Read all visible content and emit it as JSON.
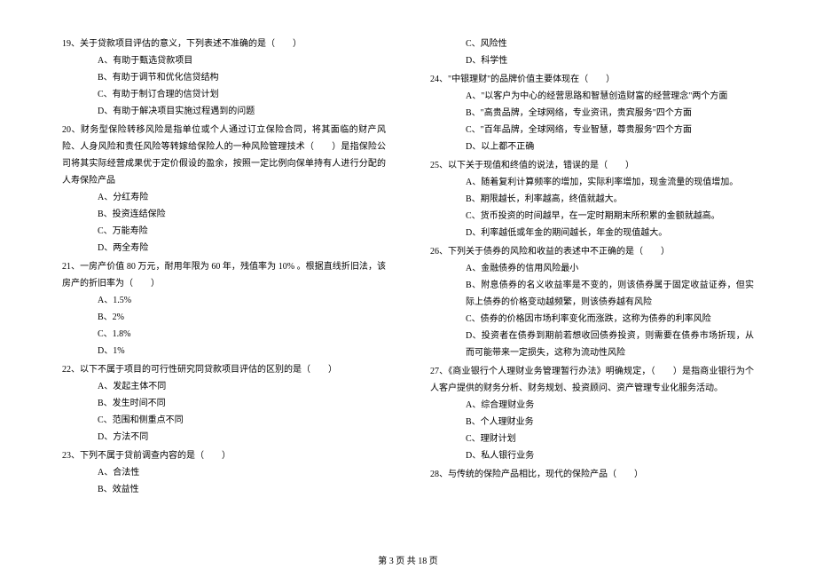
{
  "left_column": {
    "q19": {
      "text": "19、关于贷款项目评估的意义，下列表述不准确的是（　　）",
      "options": {
        "a": "A、有助于甄选贷款项目",
        "b": "B、有助于调节和优化信贷结构",
        "c": "C、有助于制订合理的信贷计划",
        "d": "D、有助于解决项目实施过程遇到的问题"
      }
    },
    "q20": {
      "text": "20、财务型保险转移风险是指单位或个人通过订立保险合同，将其面临的财产风险、人身风险和责任风险等转嫁给保险人的一种风险管理技术（　　）是指保险公司将其实际经营成果优于定价假设的盈余，按照一定比例向保单持有人进行分配的人寿保险产品",
      "options": {
        "a": "A、分红寿险",
        "b": "B、投资连结保险",
        "c": "C、万能寿险",
        "d": "D、两全寿险"
      }
    },
    "q21": {
      "text": "21、一房产价值 80 万元，耐用年限为 60 年，残值率为 10% 。根据直线折旧法，该房产的折旧率为（　　）",
      "options": {
        "a": "A、1.5%",
        "b": "B、2%",
        "c": "C、1.8%",
        "d": "D、1%"
      }
    },
    "q22": {
      "text": "22、以下不属于项目的可行性研究同贷款项目评估的区别的是（　　）",
      "options": {
        "a": "A、发起主体不同",
        "b": "B、发生时间不同",
        "c": "C、范围和侧重点不同",
        "d": "D、方法不同"
      }
    },
    "q23": {
      "text": "23、下列不属于贷前调查内容的是（　　）",
      "options": {
        "a": "A、合法性",
        "b": "B、效益性"
      }
    }
  },
  "right_column": {
    "q23_cont": {
      "options": {
        "c": "C、风险性",
        "d": "D、科学性"
      }
    },
    "q24": {
      "text": "24、\"中银理财\"的品牌价值主要体现在（　　）",
      "options": {
        "a": "A、\"以客户为中心的经营思路和智慧创造财富的经营理念\"两个方面",
        "b": "B、\"高贵品牌，全球网络，专业资讯，贵宾服务\"四个方面",
        "c": "C、\"百年品牌，全球网络，专业智慧，尊贵服务\"四个方面",
        "d": "D、以上都不正确"
      }
    },
    "q25": {
      "text": "25、以下关于现值和终值的说法，错误的是（　　）",
      "options": {
        "a": "A、随着复利计算频率的增加，实际利率增加，现金流量的现值增加。",
        "b": "B、期限越长，利率越高，终值就越大。",
        "c": "C、货币投资的时间越早，在一定时期期末所积累的金额就越高。",
        "d": "D、利率越低或年金的期间越长，年金的现值越大。"
      }
    },
    "q26": {
      "text": "26、下列关于债券的风险和收益的表述中不正确的是（　　）",
      "options": {
        "a": "A、金融债券的信用风险最小",
        "b": "B、附息债券的名义收益率是不变的，则该债券属于固定收益证券，但实际上债券的价格变动越频繁，则该债券越有风险",
        "c": "C、债券的价格因市场利率变化而涨跌，这称为债券的利率风险",
        "d": "D、投资者在债券到期前若想收回债券投资，则需要在债券市场折现，从而可能带来一定损失，这称为流动性风险"
      }
    },
    "q27": {
      "text": "27、《商业银行个人理财业务管理暂行办法》明确规定，（　　）是指商业银行为个人客户提供的财务分析、财务规划、投资顾问、资产管理专业化服务活动。",
      "options": {
        "a": "A、综合理财业务",
        "b": "B、个人理财业务",
        "c": "C、理财计划",
        "d": "D、私人银行业务"
      }
    },
    "q28": {
      "text": "28、与传统的保险产品相比，现代的保险产品（　　）"
    }
  },
  "footer": "第 3 页 共 18 页"
}
